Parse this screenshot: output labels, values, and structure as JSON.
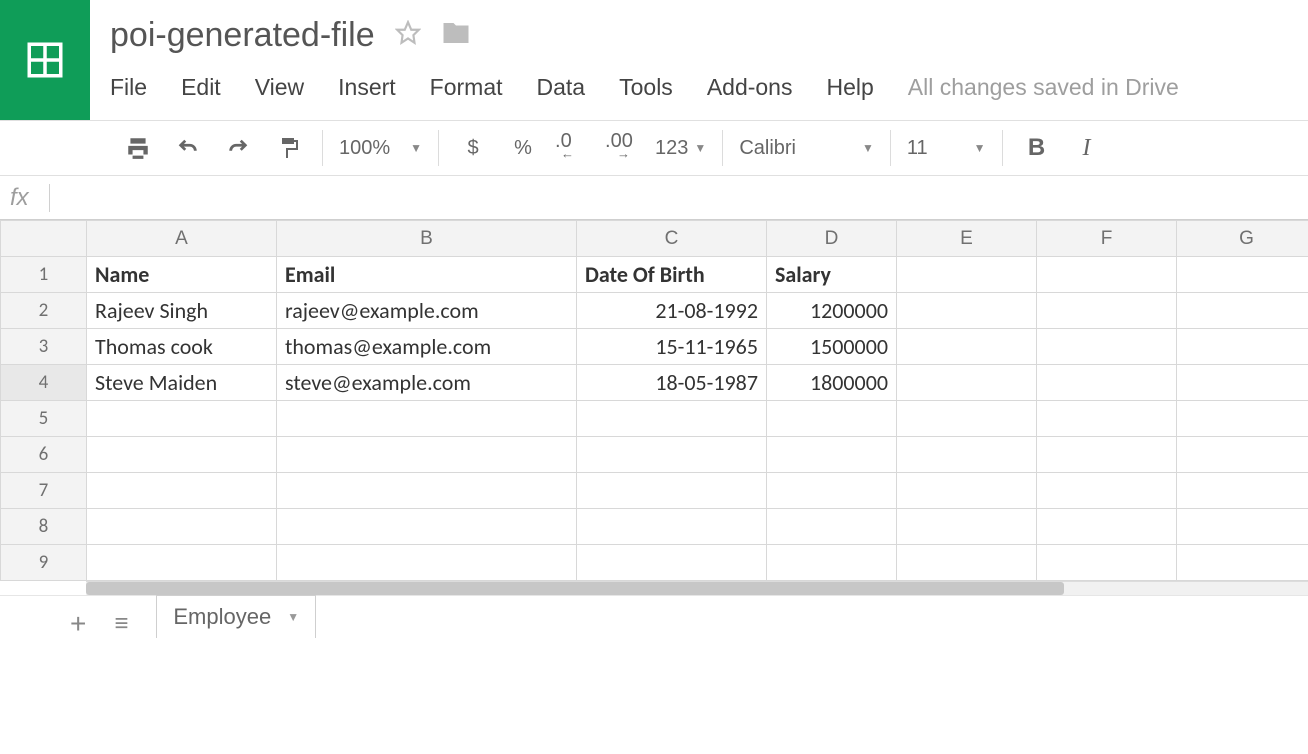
{
  "document": {
    "title": "poi-generated-file",
    "status": "All changes saved in Drive"
  },
  "menu": {
    "file": "File",
    "edit": "Edit",
    "view": "View",
    "insert": "Insert",
    "format": "Format",
    "data": "Data",
    "tools": "Tools",
    "addons": "Add-ons",
    "help": "Help"
  },
  "toolbar": {
    "zoom": "100%",
    "currency": "$",
    "percent": "%",
    "dec_dec": ".0",
    "inc_dec": ".00",
    "more_fmt": "123",
    "font": "Calibri",
    "font_size": "11",
    "bold": "B",
    "italic": "I"
  },
  "formula": {
    "label": "fx"
  },
  "columns": [
    "A",
    "B",
    "C",
    "D",
    "E",
    "F",
    "G"
  ],
  "row_numbers": [
    "1",
    "2",
    "3",
    "4",
    "5",
    "6",
    "7",
    "8",
    "9"
  ],
  "sheet": {
    "headers": {
      "name": "Name",
      "email": "Email",
      "dob": "Date Of Birth",
      "salary": "Salary"
    },
    "rows": [
      {
        "name": "Rajeev Singh",
        "email": "rajeev@example.com",
        "dob": "21-08-1992",
        "salary": "1200000"
      },
      {
        "name": "Thomas cook",
        "email": "thomas@example.com",
        "dob": "15-11-1965",
        "salary": "1500000"
      },
      {
        "name": "Steve Maiden",
        "email": "steve@example.com",
        "dob": "18-05-1987",
        "salary": "1800000"
      }
    ]
  },
  "tabs": {
    "add": "+",
    "list": "≡",
    "sheet1": "Employee"
  }
}
